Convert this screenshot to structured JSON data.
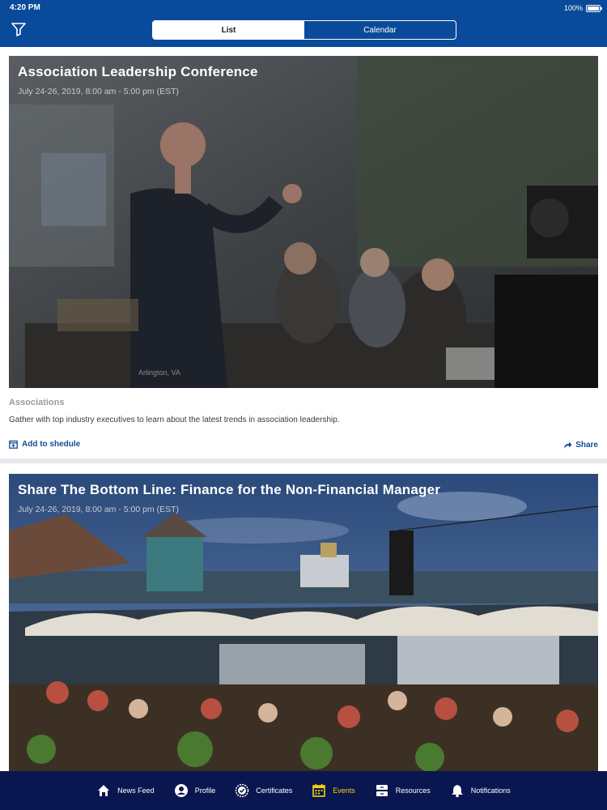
{
  "status": {
    "time": "4:20 PM",
    "battery": "100%"
  },
  "header": {
    "tabs": [
      {
        "label": "List",
        "active": true
      },
      {
        "label": "Calendar",
        "active": false
      }
    ]
  },
  "events": [
    {
      "title": "Association Leadership Conference",
      "date": "July 24-26, 2019, 8:00 am - 5:00 pm (EST)",
      "photo_caption": "Arlington, VA",
      "category": "Associations",
      "description": "Gather with top industry executives to learn about the latest trends in association leadership.",
      "add_label": "Add to shedule",
      "share_label": "Share"
    },
    {
      "title": "Share The Bottom Line: Finance for the Non-Financial Manager",
      "date": "July 24-26, 2019, 8:00 am - 5:00 pm (EST)"
    }
  ],
  "tabbar": {
    "items": [
      {
        "label": "News Feed",
        "icon": "home-icon",
        "active": false
      },
      {
        "label": "Profile",
        "icon": "profile-icon",
        "active": false
      },
      {
        "label": "Certificates",
        "icon": "certificate-icon",
        "active": false
      },
      {
        "label": "Events",
        "icon": "calendar-icon",
        "active": true
      },
      {
        "label": "Resources",
        "icon": "resources-icon",
        "active": false
      },
      {
        "label": "Notifications",
        "icon": "bell-icon",
        "active": false
      }
    ]
  },
  "colors": {
    "header": "#0a4a9a",
    "tabbar": "#0a1650",
    "accent": "#124c96",
    "active_tab": "#f5d20a"
  }
}
